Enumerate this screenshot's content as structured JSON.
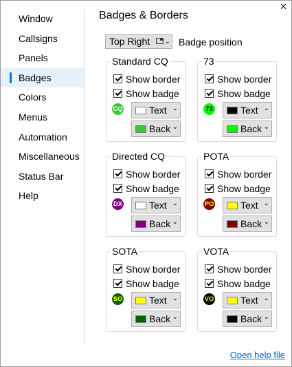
{
  "window": {
    "close_glyph": "✕"
  },
  "sidebar": {
    "items": [
      {
        "label": "Window"
      },
      {
        "label": "Callsigns"
      },
      {
        "label": "Panels"
      },
      {
        "label": "Badges",
        "active": true
      },
      {
        "label": "Colors"
      },
      {
        "label": "Menus"
      },
      {
        "label": "Automation"
      },
      {
        "label": "Miscellaneous"
      },
      {
        "label": "Status Bar"
      },
      {
        "label": "Help"
      }
    ]
  },
  "main": {
    "title": "Badges & Borders",
    "position": {
      "value": "Top Right",
      "label": "Badge position",
      "icon": "top-right-icon"
    },
    "show_border_label": "Show border",
    "show_badge_label": "Show badge",
    "text_label": "Text",
    "back_label": "Back",
    "groups": [
      {
        "title": "Standard CQ",
        "badge": "CQ",
        "text_color": "#ffffff",
        "back_color": "#33cc33",
        "show_border": true,
        "show_badge": true
      },
      {
        "title": "73",
        "badge": "73",
        "text_color": "#000000",
        "back_color": "#00ff00",
        "show_border": true,
        "show_badge": true
      },
      {
        "title": "Directed CQ",
        "badge": "DX",
        "text_color": "#ffffff",
        "back_color": "#800080",
        "show_border": true,
        "show_badge": true
      },
      {
        "title": "POTA",
        "badge": "PO",
        "text_color": "#ffff00",
        "back_color": "#800000",
        "show_border": true,
        "show_badge": true
      },
      {
        "title": "SOTA",
        "badge": "SO",
        "text_color": "#ffff00",
        "back_color": "#006400",
        "show_border": true,
        "show_badge": true
      },
      {
        "title": "VOTA",
        "badge": "VO",
        "text_color": "#ffff00",
        "back_color": "#000000",
        "show_border": true,
        "show_badge": true
      }
    ]
  },
  "footer": {
    "help_link": "Open help file"
  }
}
